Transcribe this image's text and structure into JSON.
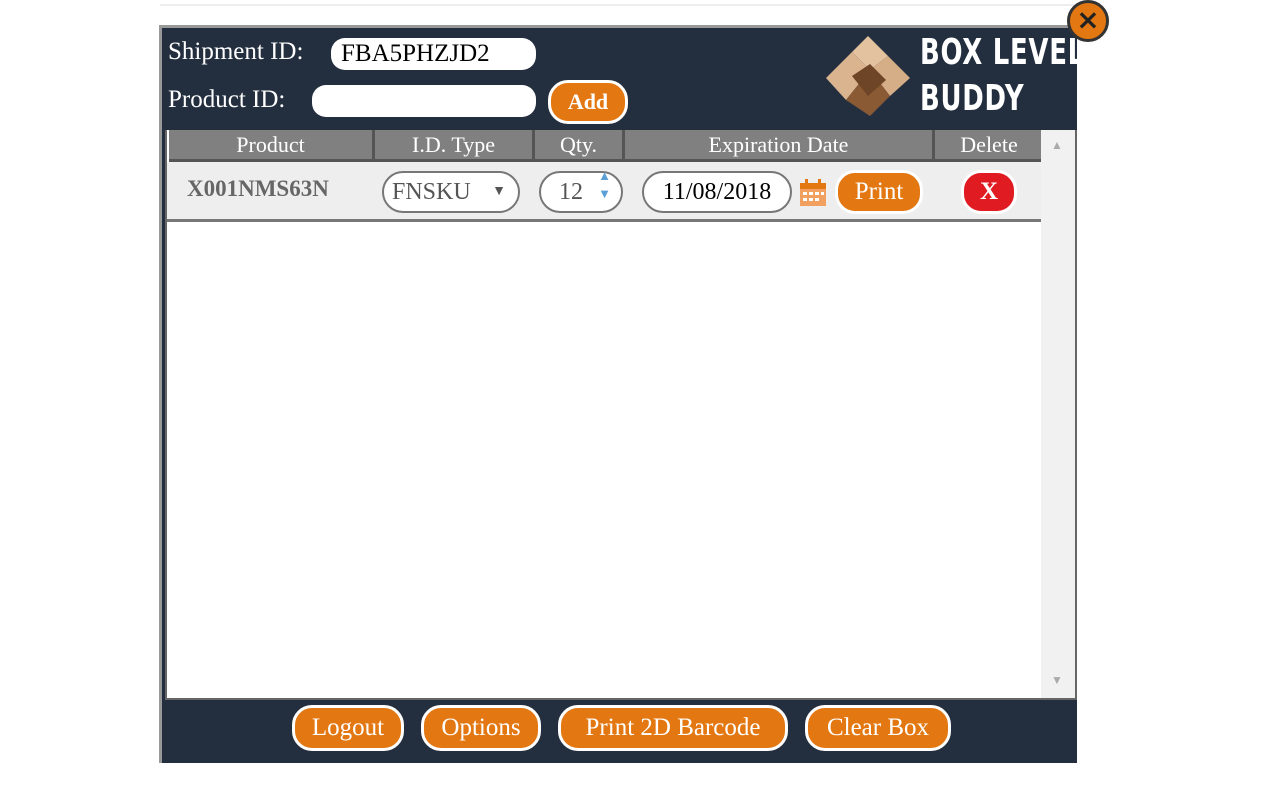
{
  "header": {
    "shipment_label": "Shipment ID:",
    "shipment_value": "FBA5PHZJD2",
    "product_label": "Product ID:",
    "product_value": "",
    "add_label": "Add",
    "logo_line1": "BOX LEVEL",
    "logo_line2": "BUDDY"
  },
  "table": {
    "columns": [
      "Product",
      "I.D. Type",
      "Qty.",
      "Expiration Date",
      "Delete"
    ],
    "rows": [
      {
        "product": "X001NMS63N",
        "id_type": "FNSKU",
        "qty": "12",
        "expiration": "11/08/2018",
        "print_label": "Print",
        "delete_label": "X"
      }
    ]
  },
  "footer": {
    "buttons": [
      "Logout",
      "Options",
      "Print 2D Barcode",
      "Clear Box"
    ]
  },
  "colors": {
    "accent": "#e37711",
    "background": "#232f3f",
    "delete": "#e01b22"
  }
}
